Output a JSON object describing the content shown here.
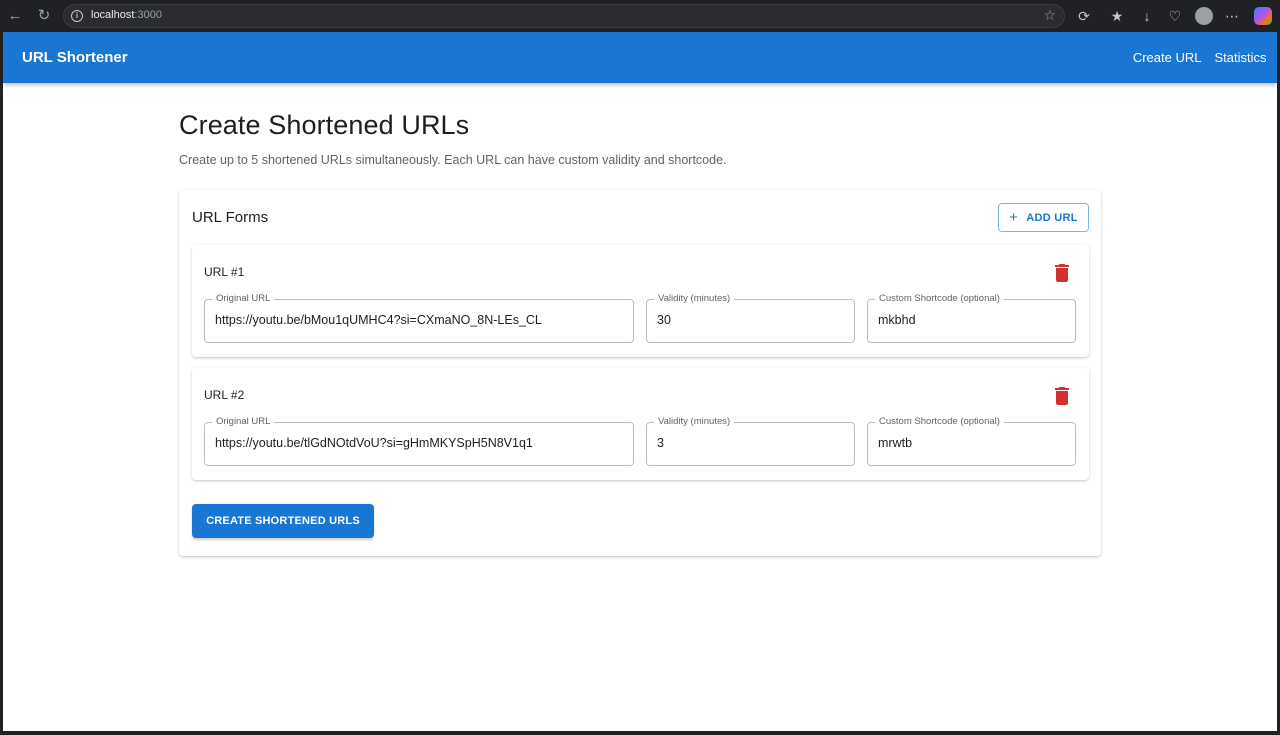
{
  "browser": {
    "url_host": "localhost",
    "url_port": ":3000"
  },
  "appbar": {
    "title": "URL Shortener",
    "nav": [
      "Create URL",
      "Statistics"
    ]
  },
  "page": {
    "title": "Create Shortened URLs",
    "subtitle": "Create up to 5 shortened URLs simultaneously. Each URL can have custom validity and shortcode."
  },
  "forms_card": {
    "title": "URL Forms",
    "add_button": "ADD URL",
    "field_labels": {
      "original": "Original URL",
      "validity": "Validity (minutes)",
      "shortcode": "Custom Shortcode (optional)"
    },
    "items": [
      {
        "title": "URL #1",
        "original_url": "https://youtu.be/bMou1qUMHC4?si=CXmaNO_8N-LEs_CL",
        "validity": "30",
        "shortcode": "mkbhd"
      },
      {
        "title": "URL #2",
        "original_url": "https://youtu.be/tlGdNOtdVoU?si=gHmMKYSpH5N8V1q1",
        "validity": "3",
        "shortcode": "mrwtb"
      }
    ],
    "submit_button": "CREATE SHORTENED URLS"
  },
  "colors": {
    "primary": "#1976d2",
    "delete": "#d32f2f"
  }
}
